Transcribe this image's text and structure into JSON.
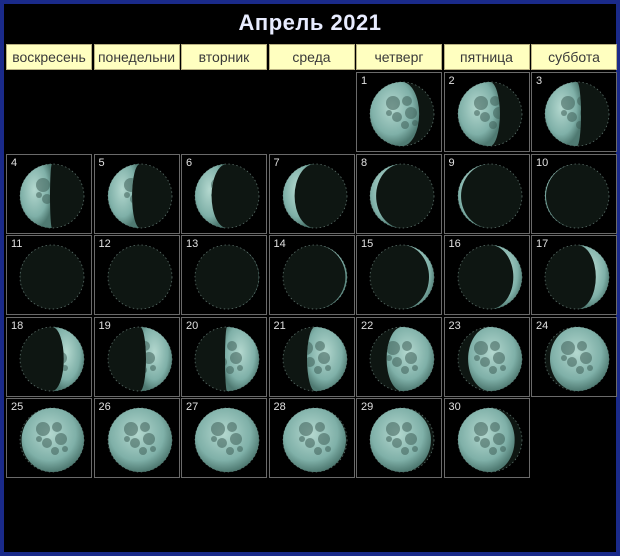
{
  "calendar": {
    "title": "Апрель 2021",
    "weekdays": [
      "воскресень",
      "понедельни",
      "вторник",
      "среда",
      "четверг",
      "пятница",
      "суббота"
    ],
    "first_weekday_index": 4,
    "days": [
      {
        "day": "1",
        "phase": 0.66
      },
      {
        "day": "2",
        "phase": 0.7
      },
      {
        "day": "3",
        "phase": 0.73
      },
      {
        "day": "4",
        "phase": 0.76
      },
      {
        "day": "5",
        "phase": 0.79
      },
      {
        "day": "6",
        "phase": 0.83
      },
      {
        "day": "7",
        "phase": 0.86
      },
      {
        "day": "8",
        "phase": 0.9
      },
      {
        "day": "9",
        "phase": 0.93
      },
      {
        "day": "10",
        "phase": 0.96
      },
      {
        "day": "11",
        "phase": 0.99
      },
      {
        "day": "12",
        "phase": 0.0
      },
      {
        "day": "13",
        "phase": 0.02
      },
      {
        "day": "14",
        "phase": 0.05
      },
      {
        "day": "15",
        "phase": 0.09
      },
      {
        "day": "16",
        "phase": 0.12
      },
      {
        "day": "17",
        "phase": 0.15
      },
      {
        "day": "18",
        "phase": 0.19
      },
      {
        "day": "19",
        "phase": 0.22
      },
      {
        "day": "20",
        "phase": 0.26
      },
      {
        "day": "21",
        "phase": 0.29
      },
      {
        "day": "22",
        "phase": 0.33
      },
      {
        "day": "23",
        "phase": 0.37
      },
      {
        "day": "24",
        "phase": 0.41
      },
      {
        "day": "25",
        "phase": 0.45
      },
      {
        "day": "26",
        "phase": 0.48
      },
      {
        "day": "27",
        "phase": 0.51
      },
      {
        "day": "28",
        "phase": 0.54
      },
      {
        "day": "29",
        "phase": 0.57
      },
      {
        "day": "30",
        "phase": 0.61
      }
    ]
  },
  "colors": {
    "frame": "#1a2a8a",
    "header_bg": "#ffffc0",
    "moon_light": "#7fb0a8",
    "moon_dark": "#0e1612"
  }
}
